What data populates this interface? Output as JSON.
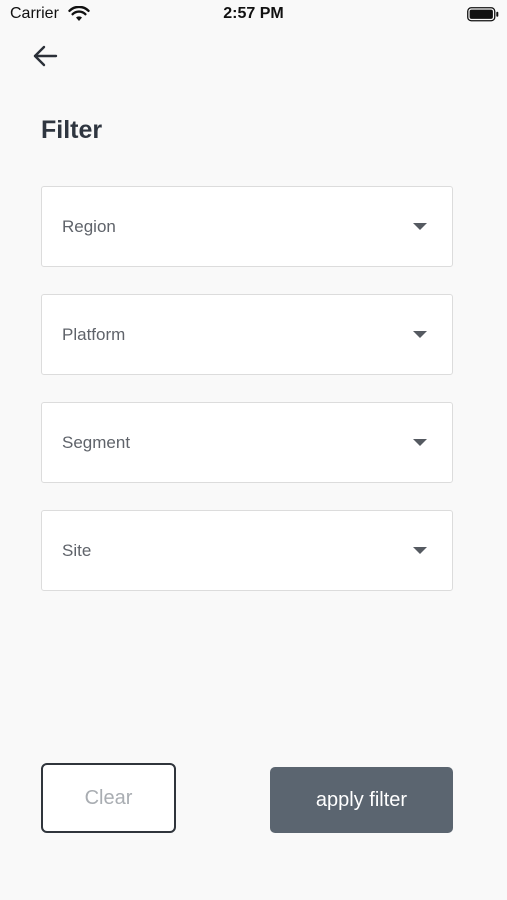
{
  "status_bar": {
    "carrier": "Carrier",
    "time": "2:57 PM",
    "icons": [
      "wifi-icon",
      "battery-icon"
    ]
  },
  "nav": {
    "back_icon": "arrow-left-icon"
  },
  "page": {
    "title": "Filter"
  },
  "filters": {
    "region": {
      "placeholder": "Region",
      "icon": "chevron-down-icon"
    },
    "platform": {
      "placeholder": "Platform",
      "icon": "chevron-down-icon"
    },
    "segment": {
      "placeholder": "Segment",
      "icon": "chevron-down-icon"
    },
    "site": {
      "placeholder": "Site",
      "icon": "chevron-down-icon"
    }
  },
  "actions": {
    "clear_label": "Clear",
    "apply_label": "apply filter"
  },
  "colors": {
    "background": "#f9f9f9",
    "apply_button": "#5b6570",
    "clear_border": "#30353c",
    "clear_text": "#a9adb2"
  }
}
